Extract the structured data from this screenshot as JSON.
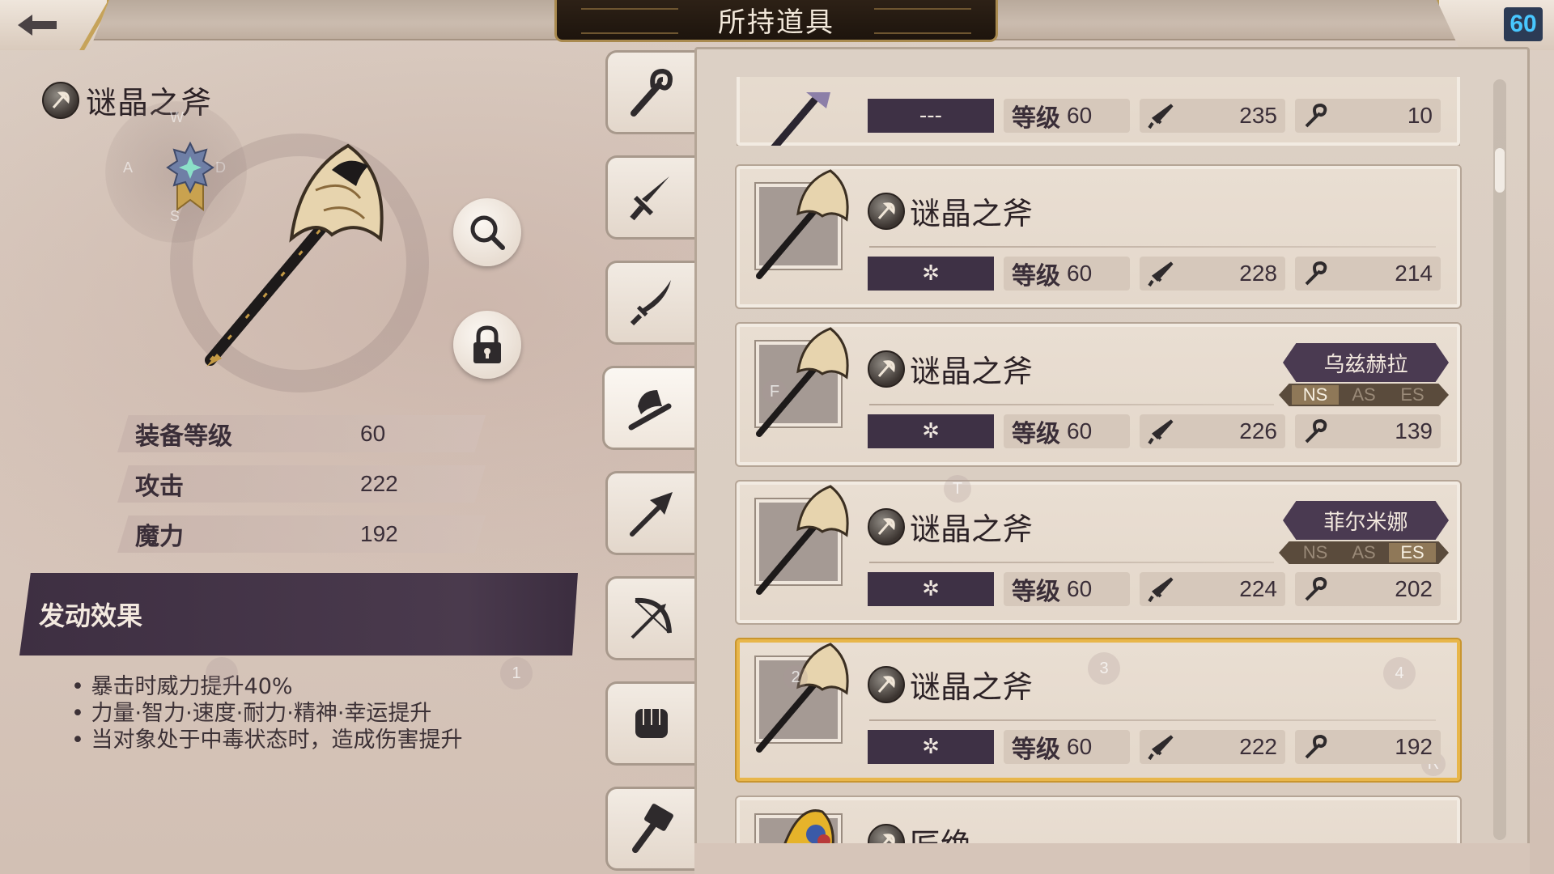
{
  "header": {
    "title": "所持道具",
    "player_level": "60"
  },
  "detail": {
    "item_name": "谜晶之斧",
    "compass": {
      "n": "W",
      "w": "A",
      "e": "D",
      "s": "S"
    },
    "stats": [
      {
        "label": "装备等级",
        "value": "60"
      },
      {
        "label": "攻击",
        "value": "222"
      },
      {
        "label": "魔力",
        "value": "192"
      }
    ],
    "effect_title": "发动效果",
    "effects": [
      "暴击时威力提升40%",
      "力量·智力·速度·耐力·精神·幸运提升",
      "当对象处于中毒状态时，造成伤害提升"
    ]
  },
  "tabs": [
    {
      "name": "staff"
    },
    {
      "name": "sword"
    },
    {
      "name": "katana"
    },
    {
      "name": "axe"
    },
    {
      "name": "spear"
    },
    {
      "name": "bow"
    },
    {
      "name": "fist"
    },
    {
      "name": "hammer"
    }
  ],
  "list": {
    "level_label": "等级",
    "items": [
      {
        "name": "",
        "awaken": "---",
        "level": "60",
        "atk": "235",
        "mag": "10"
      },
      {
        "name": "谜晶之斧",
        "awaken": "✲",
        "level": "60",
        "atk": "228",
        "mag": "214"
      },
      {
        "name": "谜晶之斧",
        "awaken": "✲",
        "level": "60",
        "atk": "226",
        "mag": "139",
        "owner": "乌兹赫拉",
        "slots": [
          "NS",
          "AS",
          "ES"
        ]
      },
      {
        "name": "谜晶之斧",
        "awaken": "✲",
        "level": "60",
        "atk": "224",
        "mag": "202",
        "owner": "菲尔米娜",
        "slots": [
          "NS",
          "AS",
          "ES"
        ]
      },
      {
        "name": "谜晶之斧",
        "awaken": "✲",
        "level": "60",
        "atk": "222",
        "mag": "192"
      },
      {
        "name": "匠绝"
      }
    ]
  },
  "hints": {
    "h1": "1",
    "h3": "3",
    "h4": "4",
    "hT": "T",
    "hF": "F",
    "hR": "R",
    "h2": "2"
  },
  "colors": {
    "accent_gold": "#e8b64a",
    "panel_purple": "#3e3145",
    "level_blue": "#48c7ff"
  }
}
